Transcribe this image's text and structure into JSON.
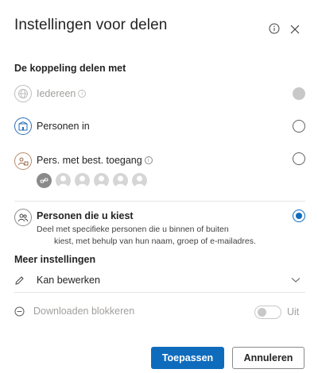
{
  "dialog": {
    "title": "Instellingen voor delen",
    "info_icon": "info-icon",
    "close_icon": "close-icon"
  },
  "share_with": {
    "heading": "De koppeling delen met",
    "options": [
      {
        "label": "Iedereen",
        "icon": "globe-icon",
        "has_info": true,
        "state": "disabled"
      },
      {
        "label": "Personen in",
        "icon": "building-icon",
        "has_info": false,
        "state": "unselected"
      },
      {
        "label": "Pers. met best. toegang",
        "icon": "people-lock-icon",
        "has_info": true,
        "state": "unselected"
      },
      {
        "label": "Personen die u kiest",
        "icon": "people-icon",
        "has_info": false,
        "state": "selected",
        "description": "Deel met specifieke personen die u binnen of buiten kiest, met behulp van hun naam, groep of e-mailadres.",
        "description_line1": "Deel met specifieke personen die u binnen of buiten",
        "description_line2": "kiest, met behulp van hun naam, groep of e-mailadres."
      }
    ]
  },
  "more_settings": {
    "heading": "Meer instellingen",
    "permission": {
      "label": "Kan bewerken",
      "icon": "pencil-icon"
    },
    "block_download": {
      "label": "Downloaden blokkeren",
      "icon": "minus-circle-icon",
      "toggle_state": "Uit"
    }
  },
  "footer": {
    "apply_label": "Toepassen",
    "cancel_label": "Annuleren"
  },
  "colors": {
    "accent": "#0f6cbd",
    "disabled": "#a19f9d"
  }
}
